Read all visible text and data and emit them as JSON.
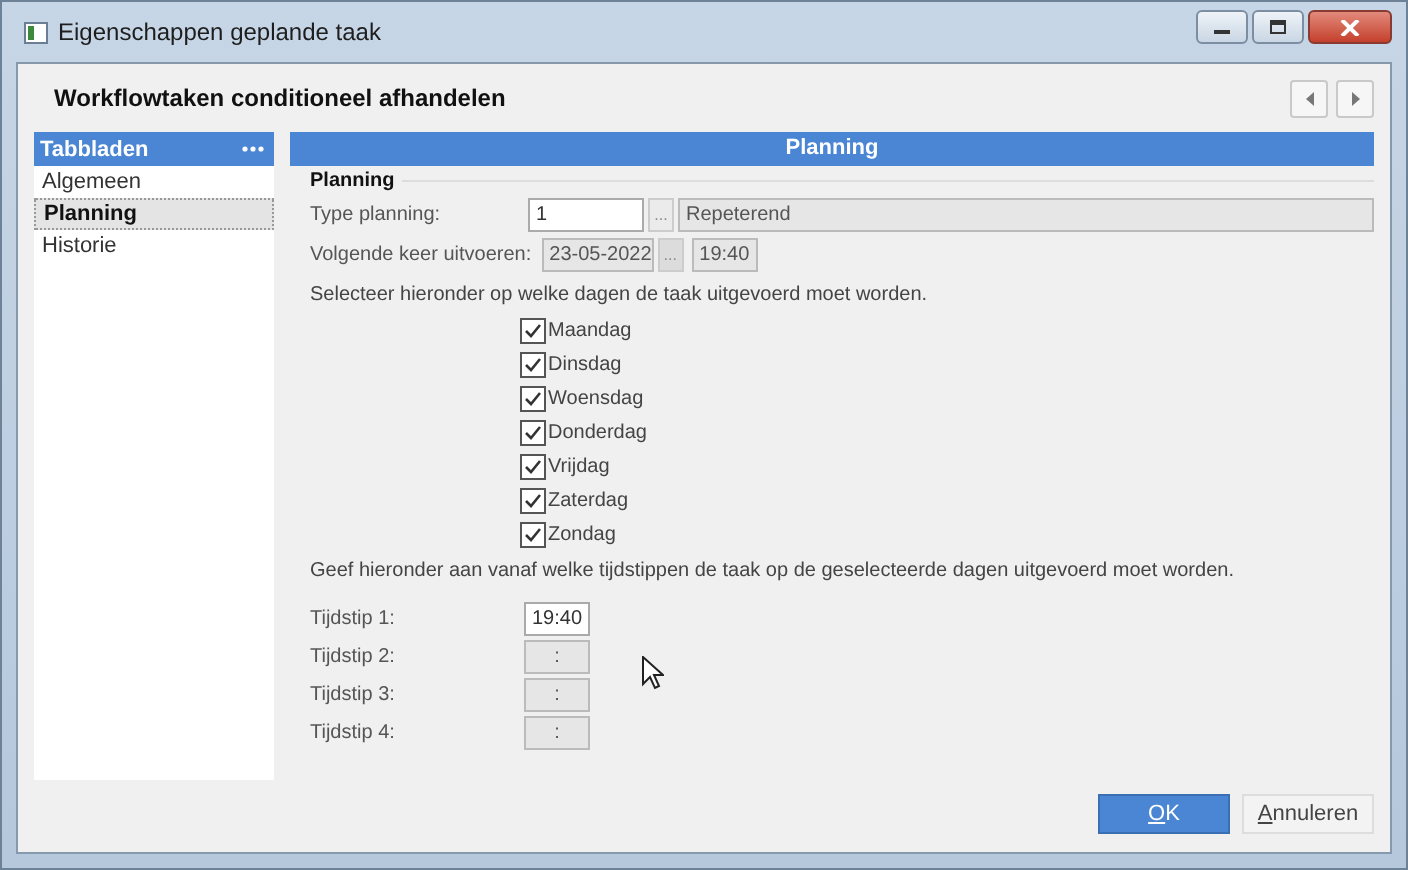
{
  "window": {
    "title": "Eigenschappen geplande taak"
  },
  "header": {
    "title": "Workflowtaken conditioneel afhandelen"
  },
  "sidebar": {
    "title": "Tabbladen",
    "items": [
      {
        "label": "Algemeen",
        "selected": false
      },
      {
        "label": "Planning",
        "selected": true
      },
      {
        "label": "Historie",
        "selected": false
      }
    ]
  },
  "panel": {
    "title": "Planning",
    "group_title": "Planning",
    "type_planning": {
      "label": "Type planning:",
      "value": "1",
      "browse": "...",
      "description": "Repeterend"
    },
    "next_run": {
      "label": "Volgende keer uitvoeren:",
      "date": "23-05-2022",
      "browse": "...",
      "time": "19:40",
      "disabled": true
    },
    "days_prompt": "Selecteer hieronder op welke dagen de taak uitgevoerd moet worden.",
    "days": [
      {
        "label": "Maandag",
        "checked": true
      },
      {
        "label": "Dinsdag",
        "checked": true
      },
      {
        "label": "Woensdag",
        "checked": true
      },
      {
        "label": "Donderdag",
        "checked": true
      },
      {
        "label": "Vrijdag",
        "checked": true
      },
      {
        "label": "Zaterdag",
        "checked": true
      },
      {
        "label": "Zondag",
        "checked": true
      }
    ],
    "times_prompt": "Geef hieronder aan vanaf welke tijdstippen de taak op de geselecteerde dagen uitgevoerd moet worden.",
    "times": [
      {
        "label": "Tijdstip 1:",
        "value": "19:40",
        "disabled": false
      },
      {
        "label": "Tijdstip 2:",
        "value": ":",
        "disabled": true
      },
      {
        "label": "Tijdstip 3:",
        "value": ":",
        "disabled": true
      },
      {
        "label": "Tijdstip 4:",
        "value": ":",
        "disabled": true
      }
    ]
  },
  "buttons": [
    {
      "label": "OK",
      "kind": "primary"
    },
    {
      "label": "Annuleren",
      "kind": "secondary"
    }
  ]
}
